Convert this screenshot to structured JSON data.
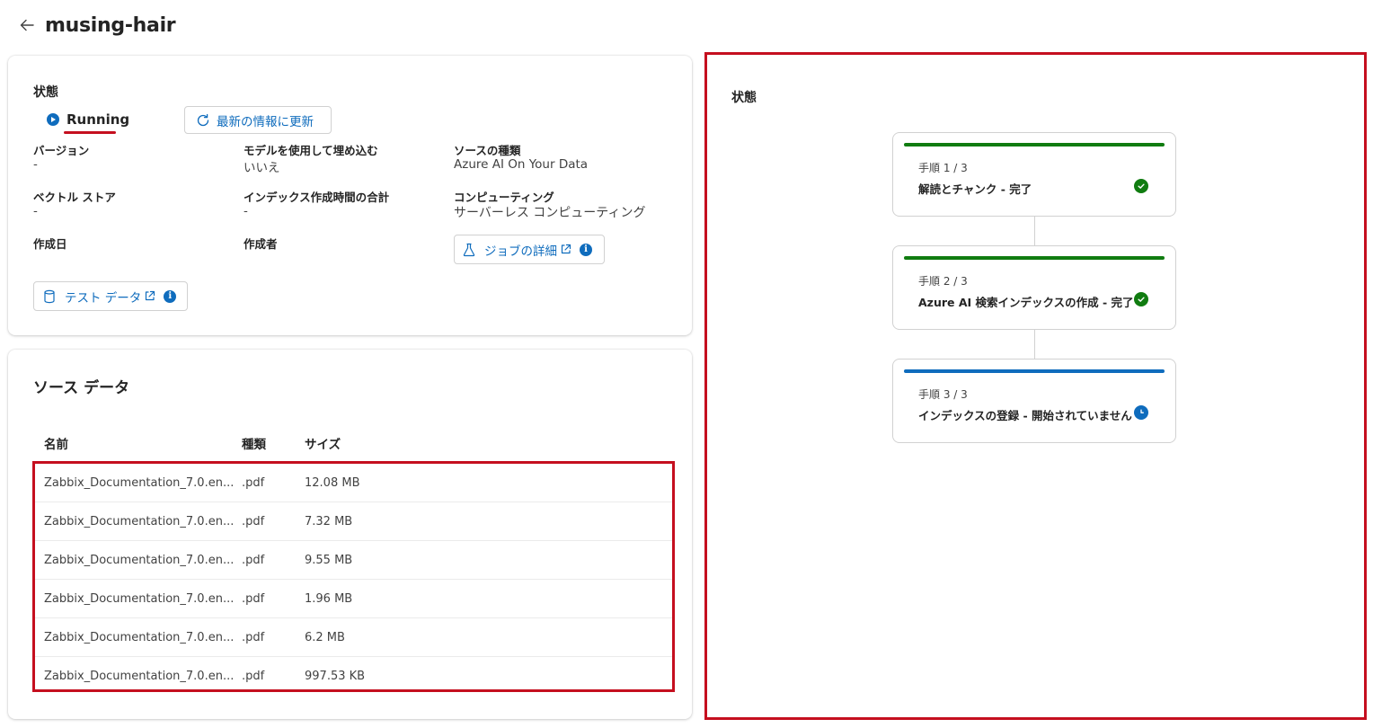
{
  "header": {
    "title": "musing-hair"
  },
  "status_card": {
    "section_label": "状態",
    "run_status": "Running",
    "refresh_label": "最新の情報に更新",
    "fields": [
      {
        "label": "バージョン",
        "value": "-"
      },
      {
        "label": "モデルを使用して埋め込む",
        "value": "いいえ"
      },
      {
        "label": "ソースの種類",
        "value": "Azure AI On Your Data"
      },
      {
        "label": "ベクトル ストア",
        "value": "-"
      },
      {
        "label": "インデックス作成時間の合計",
        "value": "-"
      },
      {
        "label": "コンピューティング",
        "value": "サーバーレス コンピューティング"
      },
      {
        "label": "作成日",
        "value": ""
      },
      {
        "label": "作成者",
        "value": ""
      }
    ],
    "job_details_label": "ジョブの詳細",
    "test_data_label": "テスト データ",
    "info_glyph": "i"
  },
  "source_data": {
    "title": "ソース データ",
    "columns": [
      "名前",
      "種類",
      "サイズ"
    ],
    "rows": [
      {
        "name": "Zabbix_Documentation_7.0.en...",
        "type": ".pdf",
        "size": "12.08 MB"
      },
      {
        "name": "Zabbix_Documentation_7.0.en...",
        "type": ".pdf",
        "size": "7.32 MB"
      },
      {
        "name": "Zabbix_Documentation_7.0.en...",
        "type": ".pdf",
        "size": "9.55 MB"
      },
      {
        "name": "Zabbix_Documentation_7.0.en...",
        "type": ".pdf",
        "size": "1.96 MB"
      },
      {
        "name": "Zabbix_Documentation_7.0.en...",
        "type": ".pdf",
        "size": "6.2 MB"
      },
      {
        "name": "Zabbix_Documentation_7.0.en...",
        "type": ".pdf",
        "size": "997.53 KB"
      }
    ]
  },
  "status_panel": {
    "title": "状態",
    "steps": [
      {
        "number": "手順 1 / 3",
        "title": "解読とチャンク - 完了",
        "state": "complete",
        "bar_color": "#107c10",
        "icon": "check-circle-icon"
      },
      {
        "number": "手順 2 / 3",
        "title": "Azure AI 検索インデックスの作成 - 完了",
        "state": "complete",
        "bar_color": "#107c10",
        "icon": "check-circle-icon"
      },
      {
        "number": "手順 3 / 3",
        "title": "インデックスの登録 - 開始されていません",
        "state": "pending",
        "bar_color": "#0f6cbd",
        "icon": "clock-icon"
      }
    ]
  },
  "colors": {
    "accent": "#0f6cbd",
    "success": "#107c10",
    "highlight": "#c50f1f"
  }
}
